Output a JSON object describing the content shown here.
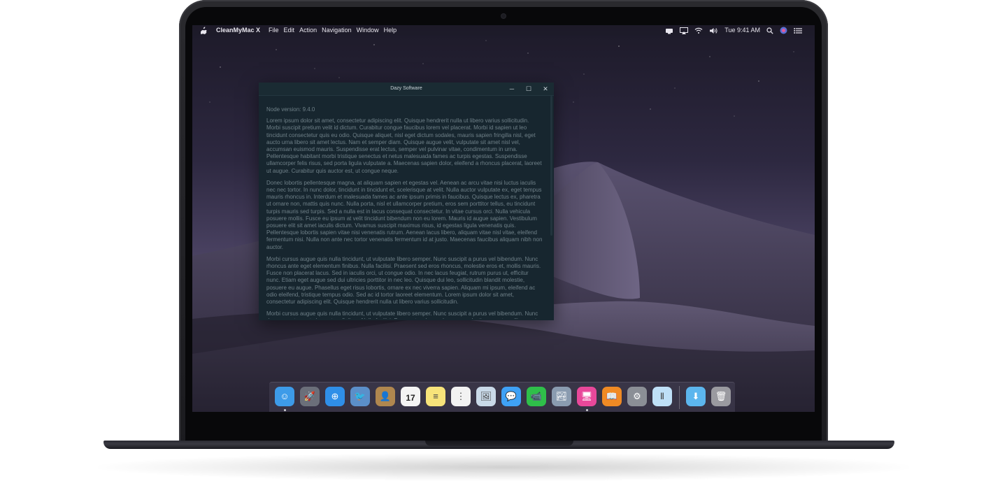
{
  "menubar": {
    "app_name": "CleanMyMac X",
    "menus": [
      "File",
      "Edit",
      "Action",
      "Navigation",
      "Window",
      "Help"
    ],
    "clock": "Tue 9:41 AM",
    "status_icons": [
      "notifications-icon",
      "airplay-icon",
      "wifi-icon",
      "volume-icon",
      "search-icon",
      "siri-icon",
      "notification-center-icon"
    ]
  },
  "window": {
    "title": "Dazy Software",
    "controls": {
      "minimize": "─",
      "maximize": "☐",
      "close": "✕"
    },
    "node_version": "Node version: 9.4.0",
    "paragraphs": [
      "Lorem ipsum dolor sit amet, consectetur adipiscing elit. Quisque hendrerit nulla ut libero varius sollicitudin. Morbi suscipit pretium velit id dictum. Curabitur congue faucibus lorem vel placerat. Morbi id sapien ut leo tincidunt consectetur quis eu odio. Quisque aliquet, nisl eget dictum sodales, mauris sapien fringilla nisl, eget aucto urna libero sit amet lectus. Nam et semper diam. Quisque augue velit, vulputate sit amet nisl vel, accumsan euismod mauris. Suspendisse erat lectus, semper vel pulvinar vitae, condimentum in urna. Pellentesque habitant morbi tristique senectus et netus malesuada fames ac turpis egestas. Suspendisse ullamcorper felis risus, sed porta ligula vulputate a. Maecenas sapien dolor, eleifend a rhoncus placerat, laoreet ut augue. Curabitur quis auctor est, ut congue neque.",
      "Donec lobortis pellentesque magna, at aliquam sapien et egestas vel. Aenean ac arcu vitae nisi luctus iaculis nec nec tortor. In nunc dolor, tincidunt in tincidunt et, scelerisque at velit. Nulla auctor vulputate ex, eget tempus mauris rhoncus in. Interdum et malesuada fames ac ante ipsum primis in faucibus. Quisque lectus ex, pharetra ut ornare non, mattis quis nunc. Nulla porta, nisl et ullamcorper pretium, eros sem porttitor tellus, eu tincidunt turpis mauris sed turpis. Sed a nulla est in lacus consequat consectetur. In vitae cursus orci. Nulla vehicula posuere mollis. Fusce eu ipsum at velit tincidunt bibendum non eu lorem. Mauris id augue sapien. Vestibulum posuere elit sit amet iaculis dictum. Vivamus suscipit maximus risus, id egestas ligula venenatis quis. Pellentesque lobortis sapien vitae nisi venenatis rutrum. Aenean lacus libero, aliquam vitae nisl vitae, eleifend fermentum nisi. Nulla non ante nec tortor venenatis fermentum id at justo. Maecenas faucibus aliquam nibh non auctor.",
      "Morbi cursus augue quis nulla tincidunt, ut vulputate libero semper. Nunc suscipit a purus vel bibendum. Nunc rhoncus ante eget elementum finibus. Nulla facilisi. Praesent sed eros rhoncus, molestie eros et, mollis mauris. Fusce non placerat lacus. Sed in iaculis orci, ut congue odio. In nec lacus feugiat, rutrum purus ut, efficitur nunc. Etiam eget augue sed dui ultricies porttitor in nec leo. Quisque dui leo, sollicitudin blandit molestie, posuere eu augue. Phasellus eget risus lobortis, ornare ex nec viverra sapien. Aliquam mi ipsum, eleifend ac odio eleifend, tristique tempus odio. Sed ac id tortor laoreet elementum. Lorem ipsum dolor sit amet, consectetur adipiscing elit. Quisque hendrerit nulla ut libero varius sollicitudin.",
      "Morbi cursus augue quis nulla tincidunt, ut vulputate libero semper. Nunc suscipit a purus vel bibendum. Nunc rhoncus ante eget elementum finibus. Nulla facilisi. Praesent sed eros rhoncus, molestie eros et, mollis mauris."
    ]
  },
  "dock": {
    "calendar_day": "17",
    "apps": [
      {
        "name": "finder-icon",
        "color": "#3d9be9",
        "glyph": "☺",
        "running": true
      },
      {
        "name": "launchpad-icon",
        "color": "#6b6f7a",
        "glyph": "🚀",
        "running": false
      },
      {
        "name": "safari-icon",
        "color": "#2f8fe8",
        "glyph": "⊕",
        "running": false
      },
      {
        "name": "photo-browser-icon",
        "color": "#5b8fc9",
        "glyph": "🐦",
        "running": false
      },
      {
        "name": "contacts-icon",
        "color": "#b0874f",
        "glyph": "👤",
        "running": false
      },
      {
        "name": "calendar-icon",
        "color": "#f4f4f4",
        "glyph": "",
        "running": false
      },
      {
        "name": "notes-icon",
        "color": "#f7e37a",
        "glyph": "≡",
        "running": false
      },
      {
        "name": "reminders-icon",
        "color": "#f2f2f2",
        "glyph": "⋮",
        "running": false
      },
      {
        "name": "preview-icon",
        "color": "#c9d9e8",
        "glyph": "🖼",
        "running": false
      },
      {
        "name": "messages-icon",
        "color": "#3fa1f5",
        "glyph": "💬",
        "running": false
      },
      {
        "name": "facetime-icon",
        "color": "#2fbf4a",
        "glyph": "📹",
        "running": false
      },
      {
        "name": "image-capture-icon",
        "color": "#8a9bb0",
        "glyph": "🏞",
        "running": false
      },
      {
        "name": "cleanmymac-icon",
        "color": "#e8489a",
        "glyph": "🖥",
        "running": true
      },
      {
        "name": "books-icon",
        "color": "#f08a24",
        "glyph": "📖",
        "running": false
      },
      {
        "name": "system-preferences-icon",
        "color": "#8b8f96",
        "glyph": "⚙",
        "running": false
      },
      {
        "name": "app-store-icon",
        "color": "#bfe0f7",
        "glyph": "Ⅱ",
        "running": false
      }
    ],
    "right": [
      {
        "name": "downloads-folder-icon",
        "color": "#5cb6ee",
        "glyph": "⬇"
      },
      {
        "name": "trash-icon",
        "color": "#9a9aa0",
        "glyph": "🗑"
      }
    ]
  }
}
